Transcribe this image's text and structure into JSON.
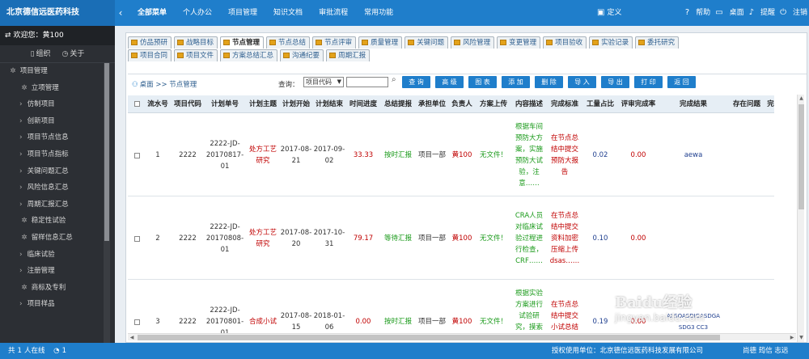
{
  "app": {
    "title": "北京德信远医药科技"
  },
  "topnav": [
    "全部菜单",
    "个人办公",
    "项目管理",
    "知识文档",
    "审批流程",
    "常用功能"
  ],
  "top_right": {
    "define": "定义",
    "help": "帮助",
    "desktop": "桌面",
    "remind": "提醒",
    "logout": "注销"
  },
  "sidebar": {
    "welcome": "欢迎您：黄100",
    "actions": [
      "组织",
      "关于"
    ],
    "items": [
      {
        "label": "项目管理",
        "level": 0,
        "icon": "gear-icon"
      },
      {
        "label": "立项管理",
        "level": 1,
        "icon": "gear-icon"
      },
      {
        "label": "仿制项目",
        "level": 2
      },
      {
        "label": "创新项目",
        "level": 2
      },
      {
        "label": "项目节点信息",
        "level": 2
      },
      {
        "label": "项目节点指标",
        "level": 2
      },
      {
        "label": "关键问题汇总",
        "level": 2
      },
      {
        "label": "风险信息汇总",
        "level": 2
      },
      {
        "label": "周期汇报汇总",
        "level": 2
      },
      {
        "label": "稳定性试验",
        "level": 1,
        "icon": "gear-icon"
      },
      {
        "label": "留样信息汇总",
        "level": 1,
        "icon": "gear-icon"
      },
      {
        "label": "临床试验",
        "level": 2
      },
      {
        "label": "注册管理",
        "level": 2
      },
      {
        "label": "商标及专利",
        "level": 1,
        "icon": "gear-icon"
      },
      {
        "label": "项目样品",
        "level": 2
      }
    ]
  },
  "tabs": {
    "row1": [
      "仿品预研",
      "战略目标",
      "节点管理",
      "节点总结",
      "节点评审",
      "质量管理",
      "关键问题",
      "风险管理",
      "变更管理",
      "项目验收",
      "实验记录",
      "委托研究"
    ],
    "row2": [
      "项目合同",
      "项目文件",
      "方案总结汇总",
      "沟通纪要",
      "周期汇报"
    ],
    "active": "节点管理"
  },
  "toolbar": {
    "breadcrumb": "桌面 >> 节点管理",
    "query_label": "查询：",
    "query_field": "项目代码",
    "query_value": "",
    "buttons": [
      "查 询",
      "高 级",
      "图 表",
      "添 加",
      "删 除",
      "导 入",
      "导 出",
      "打 印",
      "返 回"
    ]
  },
  "table": {
    "columns": [
      "流水号",
      "项目代码",
      "计划单号",
      "计划主题",
      "计划开始",
      "计划结束",
      "时间进度",
      "总结提报",
      "承担单位",
      "负责人",
      "方案上传",
      "内容描述",
      "完成标准",
      "工量占比",
      "评审完成率",
      "完成结果",
      "存在问题",
      "完"
    ],
    "rows": [
      {
        "seq": "1",
        "code": "2222",
        "plan_no": "2222-JD-20170817-01",
        "topic": "处方工艺研究",
        "start": "2017-08-21",
        "end": "2017-09-02",
        "progress": "33.33",
        "summary": "按时汇报",
        "unit": "项目一部",
        "owner": "黄100",
        "upload": "无文件！",
        "desc": "根据车间预防大方案，实施预防大试验，注意……",
        "standard": "在节点总结中提交预防大报告",
        "ratio": "0.02",
        "review_rate": "0.00",
        "result": "aewa",
        "issue": ""
      },
      {
        "seq": "2",
        "code": "2222",
        "plan_no": "2222-JD-20170808-01",
        "topic": "处方工艺研究",
        "start": "2017-08-20",
        "end": "2017-10-31",
        "progress": "79.17",
        "summary": "等待汇报",
        "unit": "项目一部",
        "owner": "黄100",
        "upload": "无文件！",
        "desc": "CRA人员对临床试验过程进行检查，CRF……",
        "standard": "在节点总结中提交资料加密压缩上传dsas……",
        "ratio": "0.10",
        "review_rate": "0.00",
        "result": "",
        "issue": ""
      },
      {
        "seq": "3",
        "code": "2222",
        "plan_no": "2222-JD-20170801-01",
        "topic": "合成小试",
        "start": "2017-08-15",
        "end": "2018-01-06",
        "progress": "0.00",
        "summary": "按时汇报",
        "unit": "项目一部",
        "owner": "黄100",
        "upload": "无文件！",
        "desc": "根据实验方案进行试验研究，摸索出工艺……",
        "standard": "在节点总结中提交小试总结报告",
        "ratio": "0.19",
        "review_rate": "0.00",
        "result": "AI SOASDIGASDGA SDG3 CC3",
        "issue": ""
      }
    ]
  },
  "status": {
    "count": "共",
    "online_num": "1",
    "online_label": "人在线",
    "msgs": "1",
    "license": "授权使用单位：北京德信远医药科技发展有限公司",
    "users": "尚德 筠信 志远"
  },
  "watermark": {
    "brand": "Baidu经验",
    "url": "jingyan.baidu.com"
  },
  "colors": {
    "primary": "#1f7ecb",
    "sidebar": "#2c2f34",
    "danger": "#c00000",
    "ok": "#1a9a1a"
  }
}
